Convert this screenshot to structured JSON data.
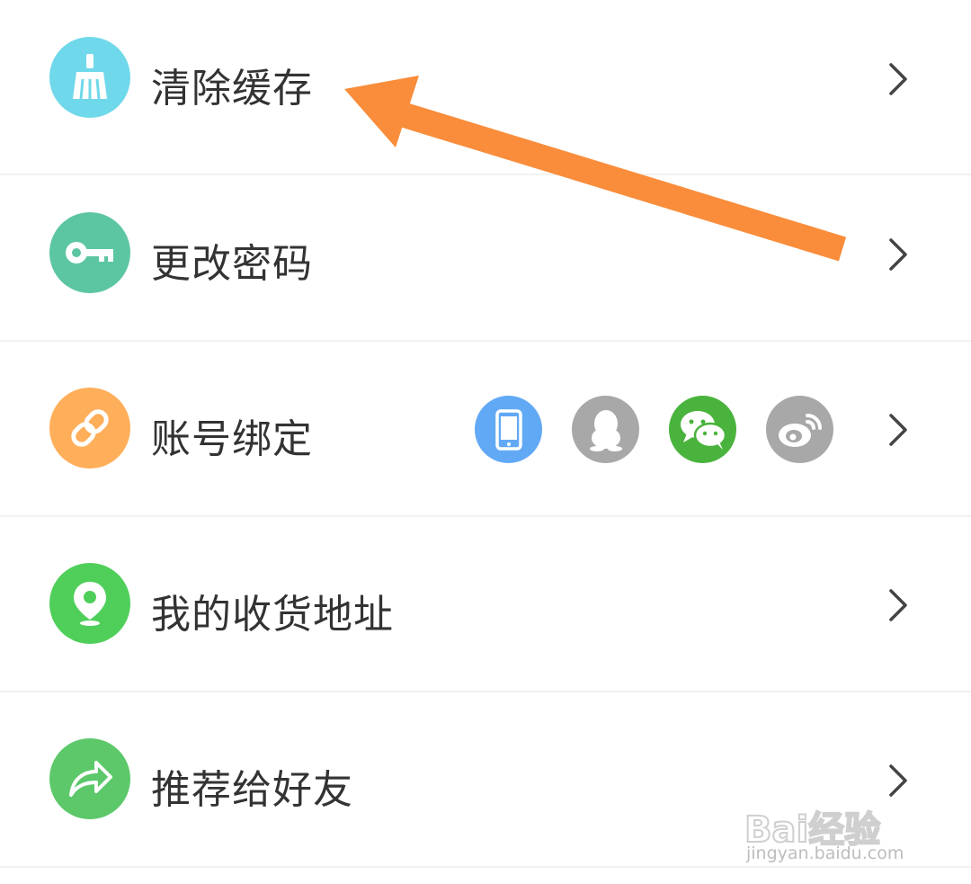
{
  "settings_list": {
    "items": [
      {
        "label": "清除缓存",
        "icon": "broom-icon",
        "color": "#6fd8ea"
      },
      {
        "label": "更改密码",
        "icon": "key-icon",
        "color": "#5cc6a3"
      },
      {
        "label": "账号绑定",
        "icon": "link-icon",
        "color": "#ffae5a"
      },
      {
        "label": "我的收货地址",
        "icon": "location-pin-icon",
        "color": "#4fcf5a"
      },
      {
        "label": "推荐给好友",
        "icon": "share-arrow-icon",
        "color": "#5cc86a"
      }
    ],
    "chevron_icon": "chevron-right-icon"
  },
  "account_binding": {
    "services": [
      {
        "name": "phone",
        "icon": "phone-icon",
        "color": "#62a9f5"
      },
      {
        "name": "qq",
        "icon": "qq-penguin-icon",
        "color": "#a8a8a8"
      },
      {
        "name": "wechat",
        "icon": "wechat-icon",
        "color": "#4ab33d"
      },
      {
        "name": "weibo",
        "icon": "weibo-icon",
        "color": "#a8a8a8"
      }
    ]
  },
  "annotation": {
    "arrow_icon": "pointer-arrow-icon",
    "arrow_color": "#f98d3b"
  },
  "watermark": {
    "main": "Bai经验",
    "sub": "jingyan.baidu.com"
  }
}
